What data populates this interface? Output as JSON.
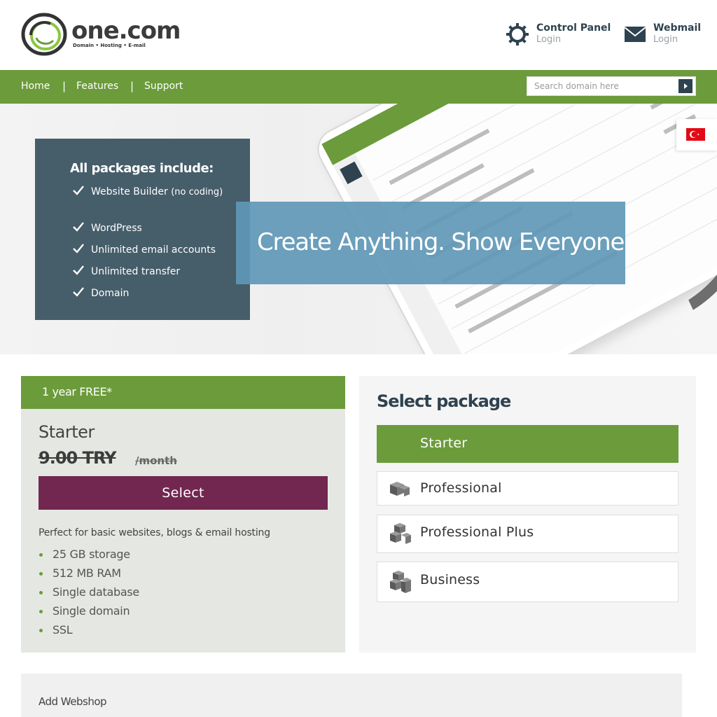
{
  "header": {
    "logo_text": "one.com",
    "logo_tagline": "Domain • Hosting • E-mail",
    "control_panel": {
      "title": "Control Panel",
      "sub": "Login",
      "icon": "gear-icon"
    },
    "webmail": {
      "title": "Webmail",
      "sub": "Login",
      "icon": "envelope-icon"
    }
  },
  "nav": {
    "items": [
      {
        "label": "Home"
      },
      {
        "label": "Features"
      },
      {
        "label": "Support"
      }
    ],
    "separator": "|",
    "search_placeholder": "Search domain here"
  },
  "hero": {
    "includes_title": "All packages include:",
    "includes": [
      {
        "label": "Website Builder",
        "note": "(no coding)"
      },
      {
        "label": "WordPress"
      },
      {
        "label": "Unlimited email accounts"
      },
      {
        "label": "Unlimited transfer"
      },
      {
        "label": "Domain"
      }
    ],
    "banner_text": "Create Anything. Show Everyone",
    "flag_country": "Turkey"
  },
  "starter_card": {
    "promo": "1 year FREE*",
    "name": "Starter",
    "price": "9.00 TRY",
    "period": "/month",
    "select_label": "Select",
    "description": "Perfect for basic websites, blogs & email hosting",
    "features": [
      "25 GB storage",
      "512 MB RAM",
      "Single database",
      "Single domain",
      "SSL"
    ]
  },
  "package_panel": {
    "title": "Select package",
    "options": [
      {
        "label": "Starter",
        "active": true
      },
      {
        "label": "Professional",
        "active": false
      },
      {
        "label": "Professional Plus",
        "active": false
      },
      {
        "label": "Business",
        "active": false
      }
    ]
  },
  "webshop": {
    "label": "Add Webshop"
  },
  "colors": {
    "brand_green": "#6b9b3b",
    "dark_slate": "#2e4250",
    "select_purple": "#722750",
    "includes_bg": "#465d6a",
    "banner_blue": "#6098b6"
  }
}
